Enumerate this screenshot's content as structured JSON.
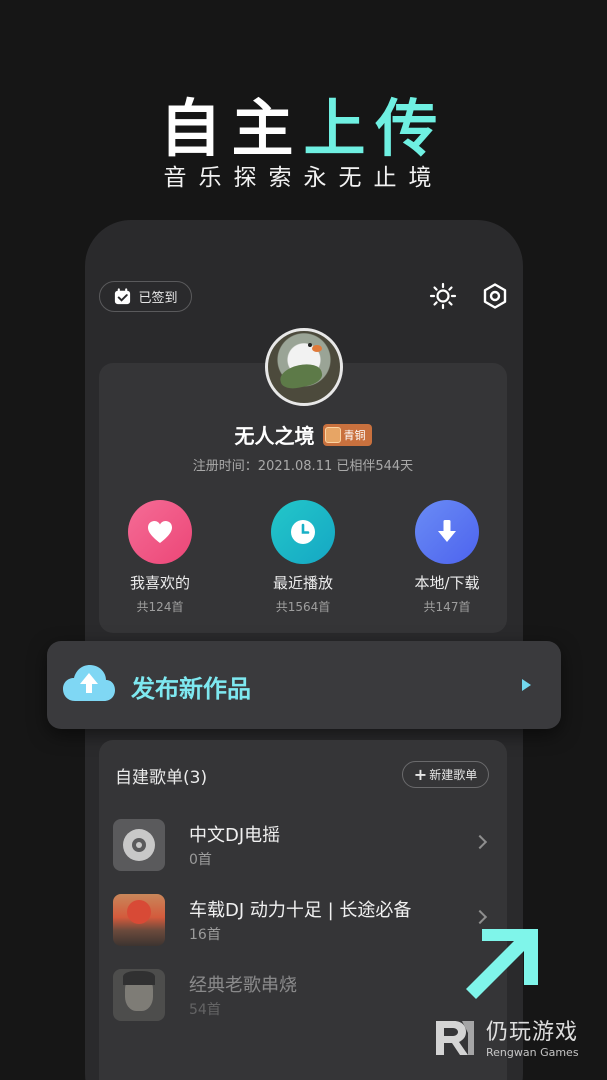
{
  "promo": {
    "headline_white": "自主",
    "headline_accent": "上传",
    "tagline": "音乐探索永无止境",
    "accent_color": "#6ff0e2"
  },
  "top_bar": {
    "signin_label": "已签到",
    "signin_icon": "calendar-check-icon",
    "theme_icon": "sun-icon",
    "settings_icon": "hexagon-settings-icon"
  },
  "profile": {
    "username": "无人之境",
    "badge_label": "青铜",
    "register_text": "注册时间：2021.08.11  已相伴544天"
  },
  "shortcuts": [
    {
      "label": "我喜欢的",
      "count": "共124首",
      "icon": "heart-icon",
      "color": "#f0578a"
    },
    {
      "label": "最近播放",
      "count": "共1564首",
      "icon": "clock-icon",
      "color": "#1fb8c8"
    },
    {
      "label": "本地/下载",
      "count": "共147首",
      "icon": "download-icon",
      "color": "#5b78f2"
    }
  ],
  "publish": {
    "label": "发布新作品",
    "icon": "cloud-upload-icon"
  },
  "playlists": {
    "header": "自建歌单(3)",
    "new_button": "新建歌单",
    "items": [
      {
        "title": "中文DJ电摇",
        "count": "0首"
      },
      {
        "title": "车载DJ 动力十足 | 长途必备",
        "count": "16首"
      },
      {
        "title": "经典老歌串烧",
        "count": "54首"
      }
    ]
  },
  "watermark": {
    "cn": "仍玩游戏",
    "en": "Rengwan Games"
  }
}
